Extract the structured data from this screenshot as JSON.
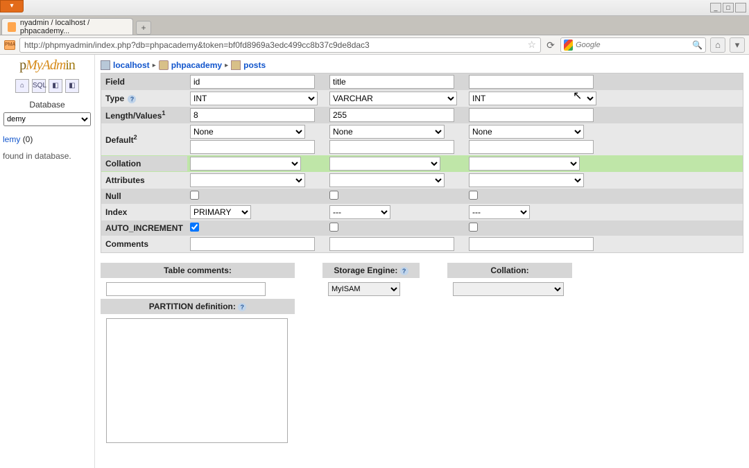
{
  "orange_tab": "▾",
  "window": {
    "min": "_",
    "max": "□",
    "close": ""
  },
  "browser": {
    "tab_title": "nyadmin / localhost / phpacademy...",
    "newtab": "+",
    "url": "http://phpmyadmin/index.php?db=phpacademy&token=bf0fd8969a3edc499cc8b37c9de8dac3",
    "search_placeholder": "Google",
    "favicon_txt": "PMA"
  },
  "sidebar": {
    "logo_p1": "p",
    "logo_p2": "MyAdm",
    "logo_p3": "in",
    "icons": [
      "⌂",
      "SQL",
      "◧",
      "◧"
    ],
    "db_label": "Database",
    "db_select": "demy",
    "db_link": "lemy",
    "db_count": "(0)",
    "note": "found in database."
  },
  "crumb": {
    "server": "localhost",
    "db": "phpacademy",
    "table": "posts",
    "sep": "▸"
  },
  "labels": {
    "field": "Field",
    "type": "Type",
    "length": "Length/Values",
    "length_sup": "1",
    "default": "Default",
    "default_sup": "2",
    "collation": "Collation",
    "attributes": "Attributes",
    "null": "Null",
    "index": "Index",
    "auto_inc": "AUTO_INCREMENT",
    "comments": "Comments",
    "help": "?"
  },
  "columns": [
    {
      "field": "id",
      "type": "INT",
      "length": "8",
      "default": "None",
      "collation": "",
      "attr": "",
      "null": false,
      "index": "PRIMARY",
      "auto": true,
      "comment": ""
    },
    {
      "field": "title",
      "type": "VARCHAR",
      "length": "255",
      "default": "None",
      "collation": "",
      "attr": "",
      "null": false,
      "index": "---",
      "auto": false,
      "comment": ""
    },
    {
      "field": "",
      "type": "INT",
      "length": "",
      "default": "None",
      "collation": "",
      "attr": "",
      "null": false,
      "index": "---",
      "auto": false,
      "comment": ""
    }
  ],
  "opts": {
    "table_comments_label": "Table comments:",
    "table_comments": "",
    "storage_engine_label": "Storage Engine:",
    "storage_engine": "MyISAM",
    "collation_label": "Collation:",
    "collation": "",
    "partition_label": "PARTITION definition:",
    "partition": ""
  }
}
